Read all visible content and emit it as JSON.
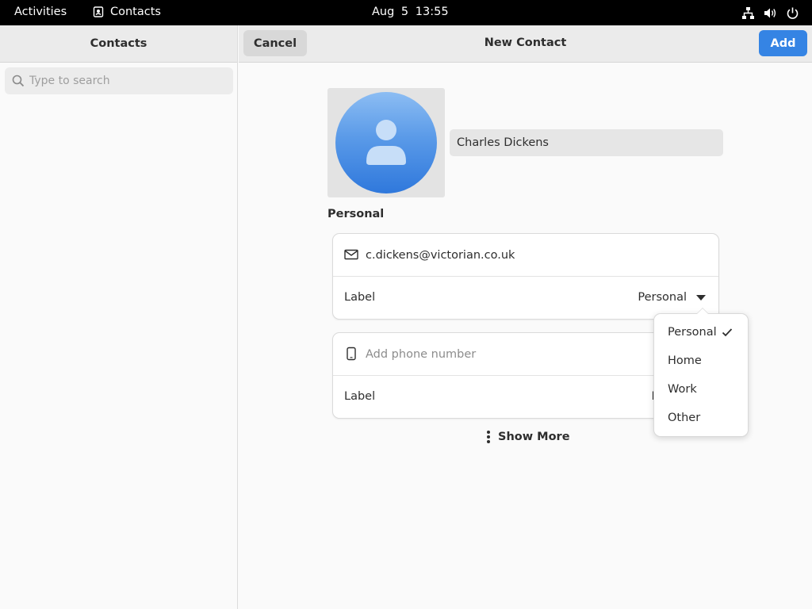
{
  "topbar": {
    "activities": "Activities",
    "app_name": "Contacts",
    "clock": "Aug 5  13:55"
  },
  "sidebar": {
    "title": "Contacts",
    "search_placeholder": "Type to search"
  },
  "main": {
    "cancel_label": "Cancel",
    "title": "New Contact",
    "add_label": "Add",
    "name_value": "Charles Dickens",
    "section_title": "Personal",
    "email": {
      "value": "c.dickens@victorian.co.uk",
      "label_title": "Label",
      "label_value": "Personal"
    },
    "phone": {
      "placeholder": "Add phone number",
      "label_title": "Label",
      "label_value": "M"
    },
    "show_more": "Show More"
  },
  "popover": {
    "items": [
      "Personal",
      "Home",
      "Work",
      "Other"
    ],
    "selected": "Personal"
  },
  "colors": {
    "accent": "#3584e4",
    "topbar": "#000000",
    "avatar_top": "#8cbdf3",
    "avatar_bottom": "#2f78dc"
  }
}
